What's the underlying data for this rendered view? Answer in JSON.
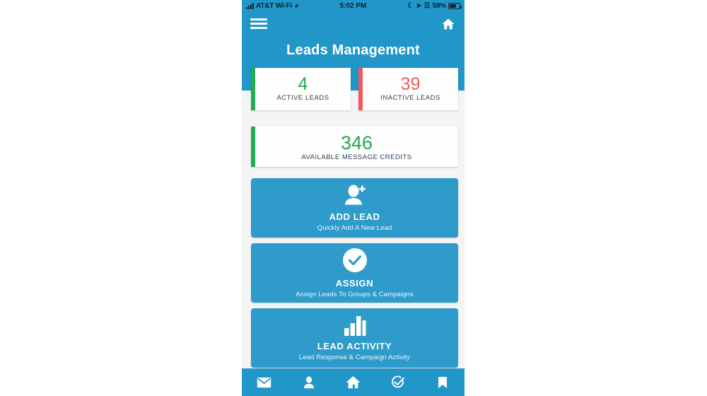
{
  "status_bar": {
    "carrier": "AT&T Wi-Fi",
    "time": "5:02 PM",
    "battery_percent": "59%",
    "icons": [
      "signal-bars-icon",
      "wifi-icon",
      "moon-icon",
      "location-arrow-icon",
      "bluetooth-icon",
      "battery-icon"
    ]
  },
  "navbar": {
    "menu_icon": "hamburger-menu-icon",
    "home_icon": "home-icon"
  },
  "header": {
    "title": "Leads Management"
  },
  "stats": [
    {
      "value": "4",
      "label": "ACTIVE LEADS",
      "accent": "#22ab52",
      "value_color": "#23a94f"
    },
    {
      "value": "39",
      "label": "INACTIVE LEADS",
      "accent": "#f2595c",
      "value_color": "#f05b5b"
    }
  ],
  "credits": {
    "value": "346",
    "label": "AVAILABLE MESSAGE CREDITS",
    "accent": "#22ab52"
  },
  "tiles": [
    {
      "title": "ADD LEAD",
      "subtitle": "Quickly Add A New Lead",
      "icon": "user-plus-icon"
    },
    {
      "title": "ASSIGN",
      "subtitle": "Assign Leads To Groups & Campaigns",
      "icon": "check-circle-icon"
    },
    {
      "title": "LEAD ACTIVITY",
      "subtitle": "Lead Response & Campaign Activity",
      "icon": "bar-chart-icon"
    }
  ],
  "tabbar": {
    "items": [
      {
        "icon": "envelope-icon"
      },
      {
        "icon": "person-icon"
      },
      {
        "icon": "home-icon"
      },
      {
        "icon": "check-circle-outline-icon"
      },
      {
        "icon": "bookmark-icon"
      }
    ]
  },
  "colors": {
    "brand_blue": "#2196c9",
    "tile_blue": "#2e9bcb",
    "green": "#22ab52",
    "red": "#f2595c",
    "page_bg": "#f4f4f4"
  }
}
